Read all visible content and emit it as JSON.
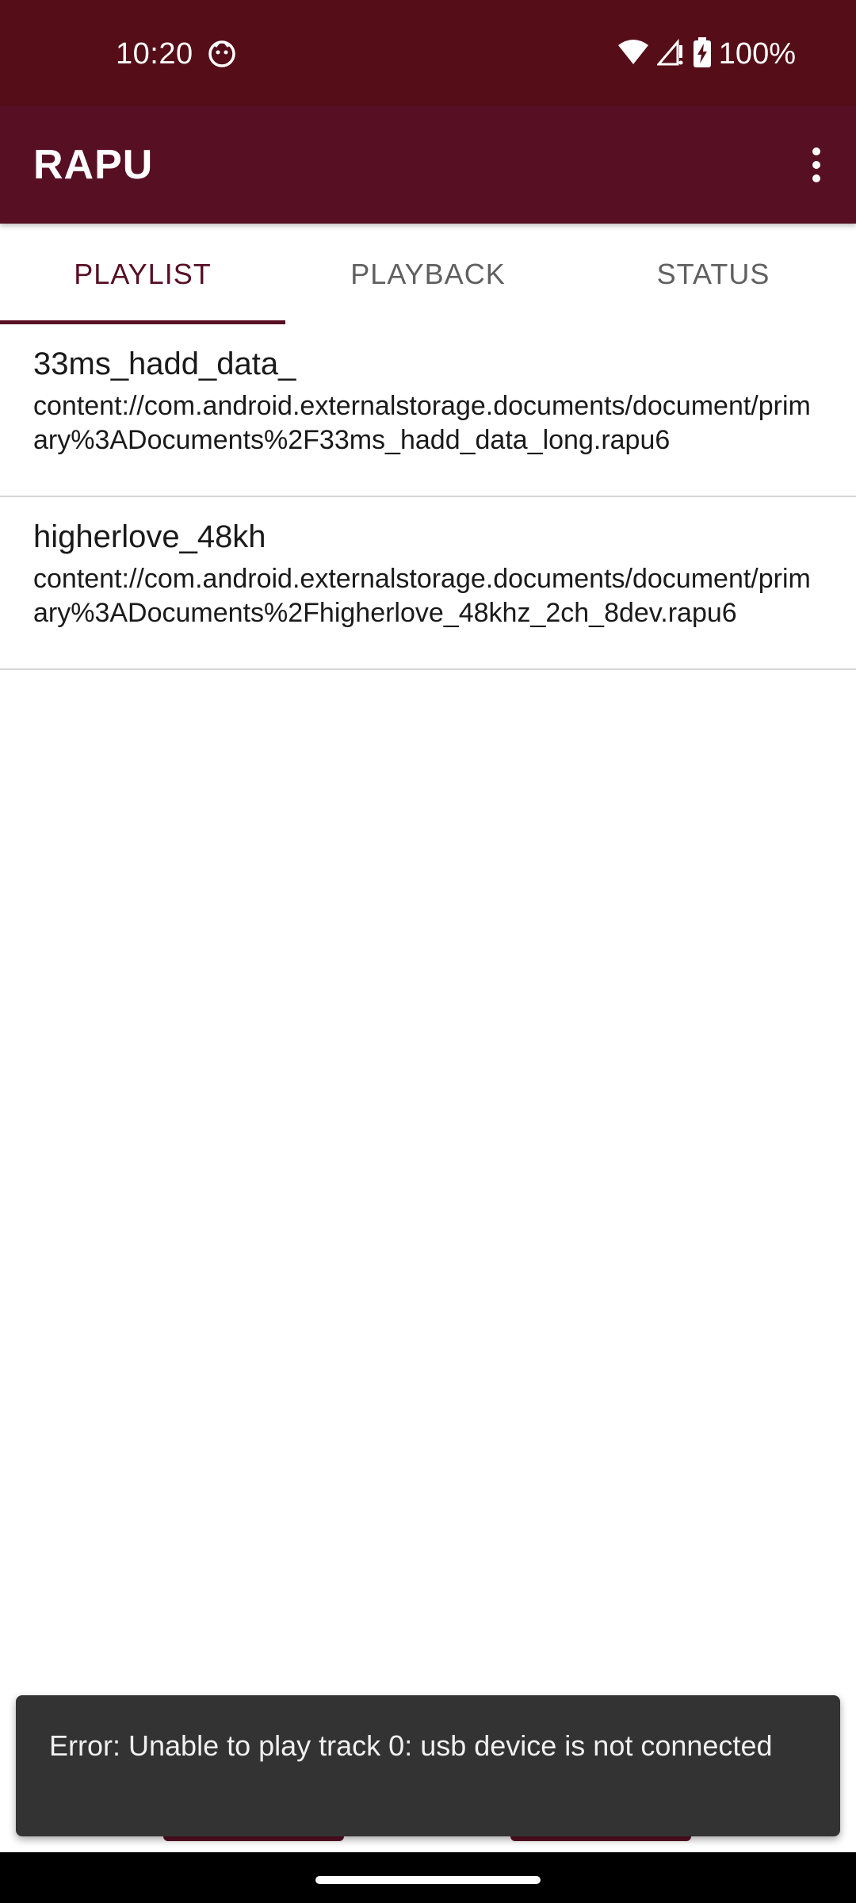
{
  "status_bar": {
    "time": "10:20",
    "battery_text": "100%",
    "icons": [
      "notification-icon",
      "wifi-icon",
      "cell-signal-icon",
      "battery-charging-icon"
    ]
  },
  "app_bar": {
    "title": "RAPU",
    "menu_icon": "more-vert-icon"
  },
  "tabs": [
    {
      "label": "PLAYLIST",
      "active": true
    },
    {
      "label": "PLAYBACK",
      "active": false
    },
    {
      "label": "STATUS",
      "active": false
    }
  ],
  "playlist": [
    {
      "title": "33ms_hadd_data_",
      "path": "content://com.android.externalstorage.documents/document/primary%3ADocuments%2F33ms_hadd_data_long.rapu6"
    },
    {
      "title": "higherlove_48kh",
      "path": "content://com.android.externalstorage.documents/document/primary%3ADocuments%2Fhigherlove_48khz_2ch_8dev.rapu6"
    }
  ],
  "snackbar": {
    "message": "Error: Unable to play track 0: usb device is not connected"
  },
  "colors": {
    "status_bar": "#550e17",
    "app_bar": "#570f24",
    "accent": "#570f24",
    "snackbar": "#333333"
  }
}
